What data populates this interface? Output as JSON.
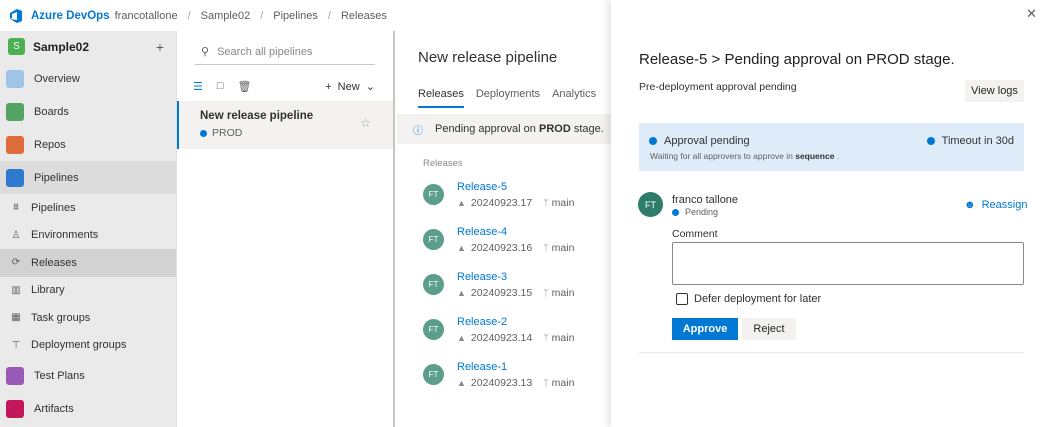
{
  "header": {
    "brand": "Azure DevOps",
    "breadcrumbs": [
      "francotallone",
      "Sample02",
      "Pipelines",
      "Releases"
    ],
    "separator": "/"
  },
  "sidebar": {
    "project": {
      "badge": "S",
      "name": "Sample02",
      "add": "+"
    },
    "items": [
      {
        "label": "Overview",
        "icon": "overview-icon",
        "color": "#a0c4e8"
      },
      {
        "label": "Boards",
        "icon": "boards-icon",
        "color": "#55a362"
      },
      {
        "label": "Repos",
        "icon": "repos-icon",
        "color": "#e06c3c"
      },
      {
        "label": "Pipelines",
        "icon": "pipelines-icon",
        "color": "#2f79d0"
      }
    ],
    "subitems": [
      {
        "label": "Pipelines",
        "icon": "pipelines-sub-icon",
        "glyph": "⩩"
      },
      {
        "label": "Environments",
        "icon": "environments-icon",
        "glyph": "♙"
      },
      {
        "label": "Releases",
        "icon": "releases-icon",
        "glyph": "⟳"
      },
      {
        "label": "Library",
        "icon": "library-icon",
        "glyph": "▥"
      },
      {
        "label": "Task groups",
        "icon": "task-groups-icon",
        "glyph": "▦"
      },
      {
        "label": "Deployment groups",
        "icon": "deployment-groups-icon",
        "glyph": "⊤"
      }
    ],
    "bottom": [
      {
        "label": "Test Plans",
        "icon": "test-plans-icon",
        "color": "#9b59b6"
      },
      {
        "label": "Artifacts",
        "icon": "artifacts-icon",
        "color": "#c2185b"
      }
    ]
  },
  "pipelines_list": {
    "search_placeholder": "Search all pipelines",
    "new_label": "New",
    "items": [
      {
        "name": "New release pipeline",
        "stage": "PROD"
      }
    ]
  },
  "release_view": {
    "title": "New release pipeline",
    "tabs": [
      "Releases",
      "Deployments",
      "Analytics"
    ],
    "banner_prefix": "Pending approval on",
    "banner_stage": "PROD",
    "banner_suffix": "stage.",
    "column_header": "Releases",
    "releases": [
      {
        "initials": "FT",
        "name": "Release-5",
        "build": "20240923.17",
        "branch": "main"
      },
      {
        "initials": "FT",
        "name": "Release-4",
        "build": "20240923.16",
        "branch": "main"
      },
      {
        "initials": "FT",
        "name": "Release-3",
        "build": "20240923.15",
        "branch": "main"
      },
      {
        "initials": "FT",
        "name": "Release-2",
        "build": "20240923.14",
        "branch": "main"
      },
      {
        "initials": "FT",
        "name": "Release-1",
        "build": "20240923.13",
        "branch": "main"
      }
    ]
  },
  "panel": {
    "title": "Release-5 > Pending approval on PROD stage.",
    "subtitle": "Pre-deployment approval pending",
    "view_logs": "View logs",
    "approval": {
      "status": "Approval pending",
      "detail_prefix": "Waiting for all approvers to approve in",
      "detail_bold": "sequence",
      "detail_suffix": ".",
      "timeout": "Timeout in 30d"
    },
    "approver": {
      "initials": "FT",
      "name": "franco tallone",
      "status": "Pending"
    },
    "reassign": "Reassign",
    "comment_label": "Comment",
    "comment_value": "",
    "defer_label": "Defer deployment for later",
    "approve": "Approve",
    "reject": "Reject"
  },
  "colors": {
    "accent": "#0078d4",
    "avatar": "#5a9e8b",
    "approval_box": "#deecf9"
  }
}
